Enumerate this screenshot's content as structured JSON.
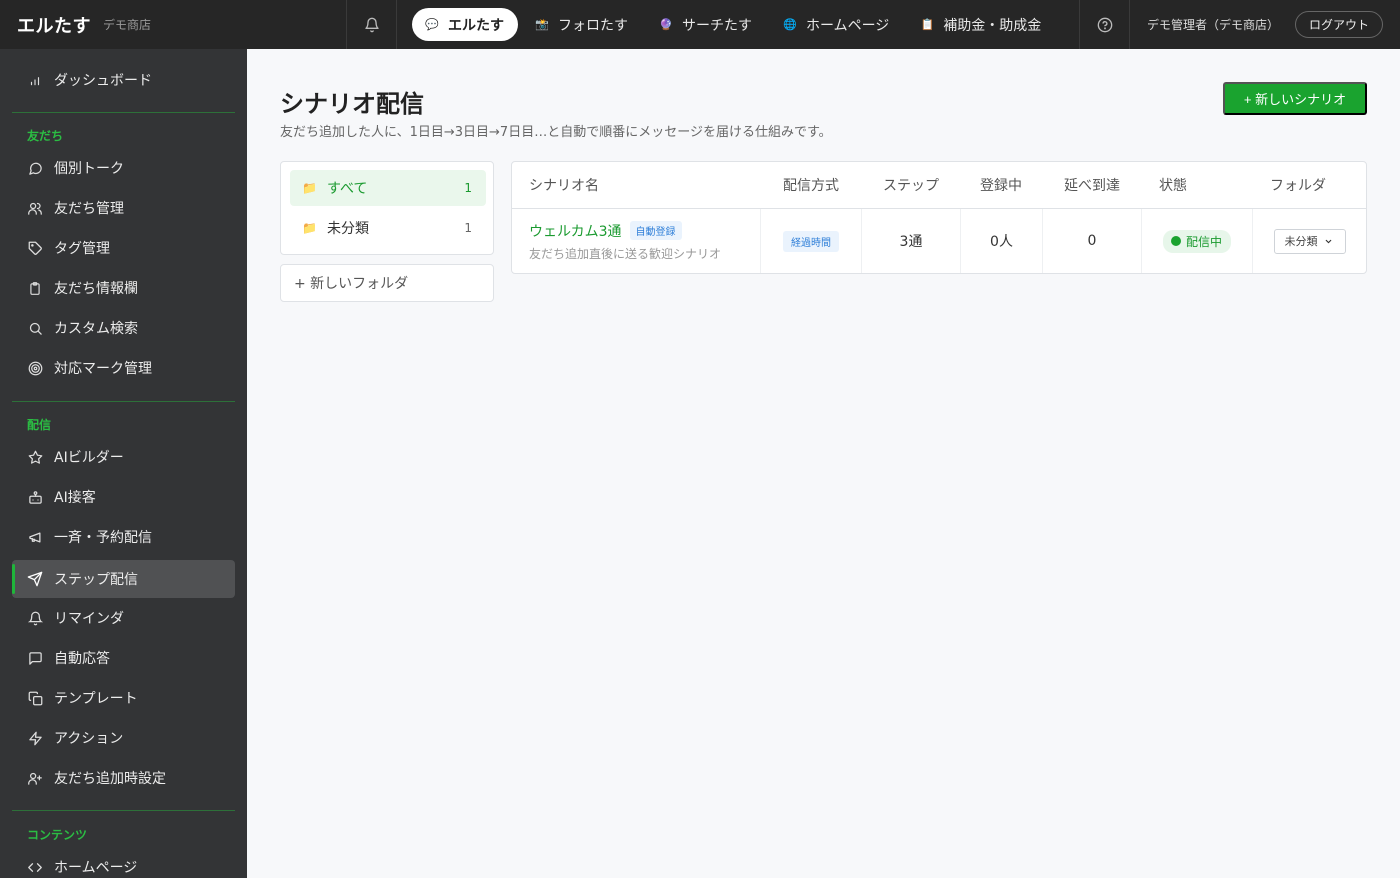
{
  "header": {
    "brand": "エルたす",
    "shop": "デモ商店",
    "apps": [
      {
        "label": "エルたす",
        "icon": "speech-bubble-icon",
        "active": true
      },
      {
        "label": "フォロたす",
        "icon": "camera-icon",
        "active": false
      },
      {
        "label": "サーチたす",
        "icon": "crystal-ball-icon",
        "active": false
      },
      {
        "label": "ホームページ",
        "icon": "globe-icon",
        "active": false
      },
      {
        "label": "補助金・助成金",
        "icon": "clipboard-icon",
        "active": false
      }
    ],
    "admin": "デモ管理者（デモ商店）",
    "logout": "ログアウト"
  },
  "sidebar": {
    "dashboard": "ダッシュボード",
    "section_friends": "友だち",
    "friends_items": [
      "個別トーク",
      "友だち管理",
      "タグ管理",
      "友だち情報欄",
      "カスタム検索",
      "対応マーク管理"
    ],
    "section_delivery": "配信",
    "delivery_items": [
      "AIビルダー",
      "AI接客",
      "一斉・予約配信",
      "ステップ配信",
      "リマインダ",
      "自動応答",
      "テンプレート",
      "アクション",
      "友だち追加時設定"
    ],
    "section_contents": "コンテンツ",
    "contents_items": [
      "ホームページ"
    ],
    "active_item": "ステップ配信"
  },
  "main": {
    "title": "シナリオ配信",
    "description": "友だち追加した人に、1日目→3日目→7日目…と自動で順番にメッセージを届ける仕組みです。",
    "new_scenario": "+ 新しいシナリオ",
    "folders": [
      {
        "label": "すべて",
        "count": "1",
        "active": true
      },
      {
        "label": "未分類",
        "count": "1",
        "active": false
      }
    ],
    "new_folder": "+ 新しいフォルダ",
    "table": {
      "headers": [
        "シナリオ名",
        "配信方式",
        "ステップ",
        "登録中",
        "延べ到達",
        "状態",
        "フォルダ"
      ],
      "rows": [
        {
          "name": "ウェルカム3通",
          "auto_badge": "自動登録",
          "description": "友だち追加直後に送る歓迎シナリオ",
          "method": "経過時間",
          "steps": "3通",
          "registered": "0人",
          "reached": "0",
          "status": "配信中",
          "folder": "未分類"
        }
      ]
    }
  },
  "colors": {
    "accent": "#1aa32f",
    "topbar": "#262626",
    "sidebar": "#333436",
    "link_blue": "#2f7fd8"
  }
}
